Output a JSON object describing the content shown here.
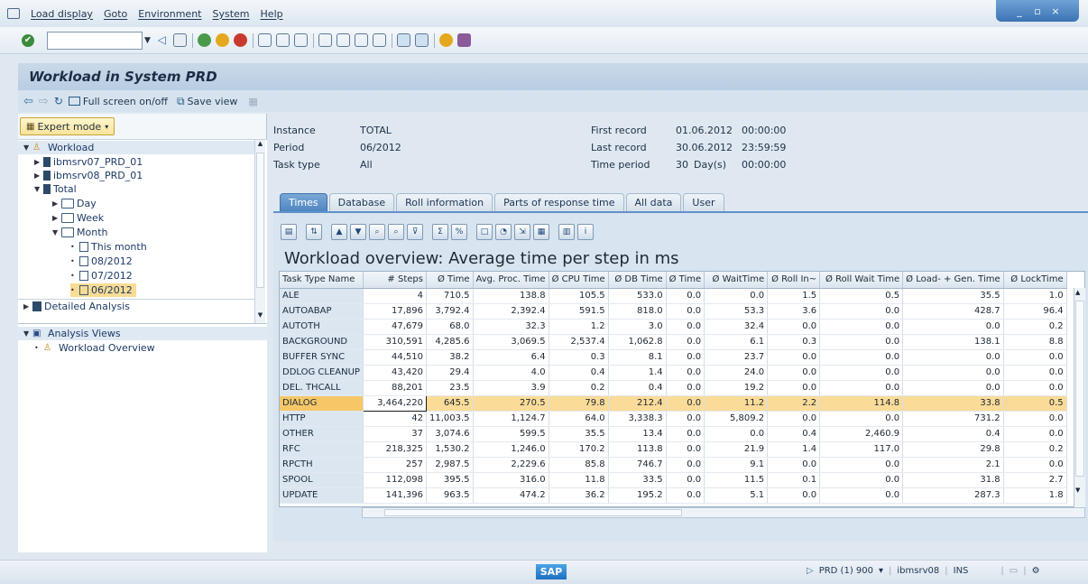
{
  "menu": [
    "Load display",
    "Goto",
    "Environment",
    "System",
    "Help"
  ],
  "window_controls": [
    "_",
    "▫",
    "×"
  ],
  "command_field": "",
  "title": "Workload in System PRD",
  "app_toolbar": {
    "fullscreen": "Full screen on/off",
    "save_view": "Save view"
  },
  "expert_mode": "Expert mode",
  "tree": {
    "workload": "Workload",
    "ibmsrv07": "ibmsrv07_PRD_01",
    "ibmsrv08": "ibmsrv08_PRD_01",
    "total": "Total",
    "day": "Day",
    "week": "Week",
    "month": "Month",
    "this_month": "This month",
    "m08": "08/2012",
    "m07": "07/2012",
    "m06": "06/2012",
    "detailed": "Detailed Analysis",
    "analysis_views": "Analysis Views",
    "workload_overview": "Workload Overview"
  },
  "info": {
    "instance_label": "Instance",
    "instance_value": "TOTAL",
    "period_label": "Period",
    "period_value": "06/2012",
    "tasktype_label": "Task type",
    "tasktype_value": "All",
    "first_label": "First record",
    "first_date": "01.06.2012",
    "first_time": "00:00:00",
    "last_label": "Last record",
    "last_date": "30.06.2012",
    "last_time": "23:59:59",
    "timeperiod_label": "Time period",
    "timeperiod_num": "30",
    "timeperiod_unit": "Day(s)",
    "timeperiod_time": "00:00:00"
  },
  "tabs": [
    "Times",
    "Database",
    "Roll information",
    "Parts of response time",
    "All data",
    "User"
  ],
  "grid": {
    "title": "Workload overview: Average time per step in ms",
    "columns": [
      "Task Type Name",
      "# Steps",
      "Ø Time",
      "Avg. Proc. Time",
      "Ø CPU Time",
      "Ø DB Time",
      "Ø Time",
      "Ø WaitTime",
      "Ø Roll In~",
      "Ø Roll Wait Time",
      "Ø Load- + Gen. Time",
      "Ø LockTime"
    ],
    "rows": [
      [
        "ALE",
        "4",
        "710.5",
        "138.8",
        "105.5",
        "533.0",
        "0.0",
        "0.0",
        "1.5",
        "0.5",
        "35.5",
        "1.0"
      ],
      [
        "AUTOABAP",
        "17,896",
        "3,792.4",
        "2,392.4",
        "591.5",
        "818.0",
        "0.0",
        "53.3",
        "3.6",
        "0.0",
        "428.7",
        "96.4"
      ],
      [
        "AUTOTH",
        "47,679",
        "68.0",
        "32.3",
        "1.2",
        "3.0",
        "0.0",
        "32.4",
        "0.0",
        "0.0",
        "0.0",
        "0.2"
      ],
      [
        "BACKGROUND",
        "310,591",
        "4,285.6",
        "3,069.5",
        "2,537.4",
        "1,062.8",
        "0.0",
        "6.1",
        "0.3",
        "0.0",
        "138.1",
        "8.8"
      ],
      [
        "BUFFER SYNC",
        "44,510",
        "38.2",
        "6.4",
        "0.3",
        "8.1",
        "0.0",
        "23.7",
        "0.0",
        "0.0",
        "0.0",
        "0.0"
      ],
      [
        "DDLOG CLEANUP",
        "43,420",
        "29.4",
        "4.0",
        "0.4",
        "1.4",
        "0.0",
        "24.0",
        "0.0",
        "0.0",
        "0.0",
        "0.0"
      ],
      [
        "DEL. THCALL",
        "88,201",
        "23.5",
        "3.9",
        "0.2",
        "0.4",
        "0.0",
        "19.2",
        "0.0",
        "0.0",
        "0.0",
        "0.0"
      ],
      [
        "DIALOG",
        "3,464,220",
        "645.5",
        "270.5",
        "79.8",
        "212.4",
        "0.0",
        "11.2",
        "2.2",
        "114.8",
        "33.8",
        "0.5"
      ],
      [
        "HTTP",
        "42",
        "11,003.5",
        "1,124.7",
        "64.0",
        "3,338.3",
        "0.0",
        "5,809.2",
        "0.0",
        "0.0",
        "731.2",
        "0.0"
      ],
      [
        "OTHER",
        "37",
        "3,074.6",
        "599.5",
        "35.5",
        "13.4",
        "0.0",
        "0.0",
        "0.4",
        "2,460.9",
        "0.4",
        "0.0"
      ],
      [
        "RFC",
        "218,325",
        "1,530.2",
        "1,246.0",
        "170.2",
        "113.8",
        "0.0",
        "21.9",
        "1.4",
        "117.0",
        "29.8",
        "0.2"
      ],
      [
        "RPCTH",
        "257",
        "2,987.5",
        "2,229.6",
        "85.8",
        "746.7",
        "0.0",
        "9.1",
        "0.0",
        "0.0",
        "2.1",
        "0.0"
      ],
      [
        "SPOOL",
        "112,098",
        "395.5",
        "316.0",
        "11.8",
        "33.5",
        "0.0",
        "11.5",
        "0.1",
        "0.0",
        "31.8",
        "2.7"
      ],
      [
        "UPDATE",
        "141,396",
        "963.5",
        "474.2",
        "36.2",
        "195.2",
        "0.0",
        "5.1",
        "0.0",
        "0.0",
        "287.3",
        "1.8"
      ]
    ],
    "highlight_row": "DIALOG"
  },
  "status": {
    "logo": "SAP",
    "system": "PRD (1) 900",
    "server": "ibmsrv08",
    "mode": "INS"
  },
  "colors": {
    "accent": "#4f86c2",
    "highlight": "#fadb98",
    "selected_tree": "#f9dc93"
  }
}
